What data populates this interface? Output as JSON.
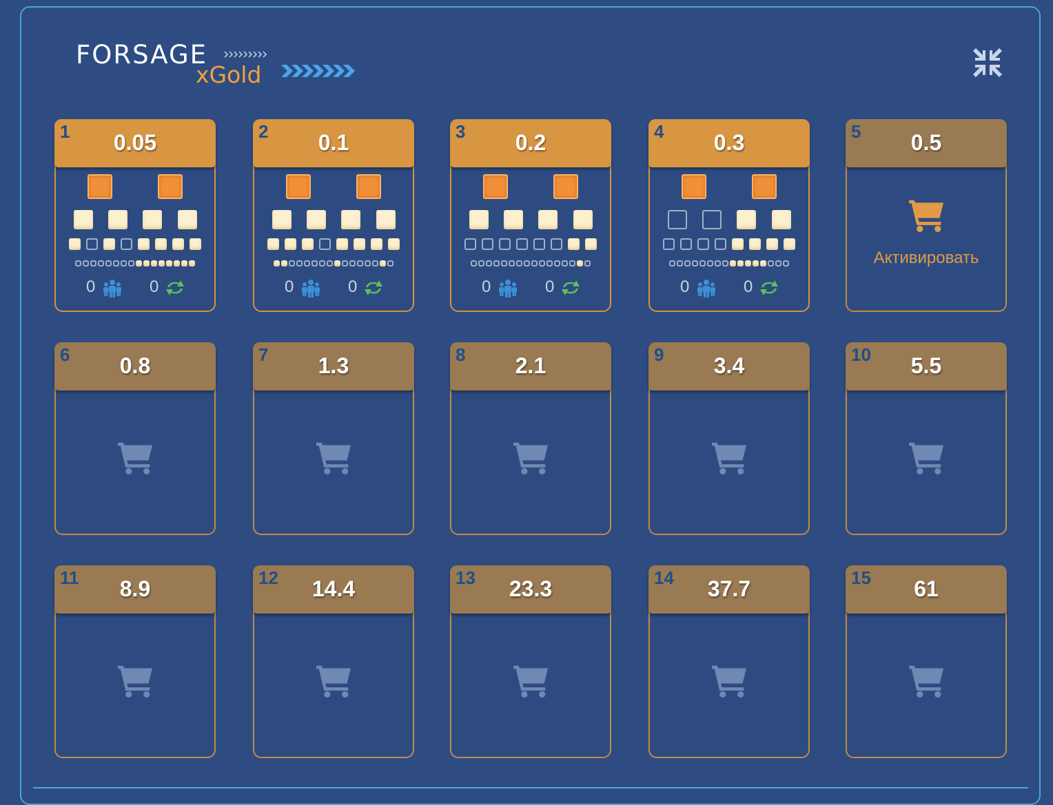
{
  "logo": {
    "brand": "FORSAGE",
    "product": "xGold"
  },
  "icons": {
    "collapse": "collapse-arrows-icon",
    "partners": "partners-icon",
    "reinvest": "reinvest-icon",
    "cart": "cart-icon"
  },
  "colors": {
    "background": "#2d4c80",
    "accent": "#d89542",
    "locked": "#9a7a52",
    "border": "#4aa6d8",
    "cart_faded": "#6f88b4"
  },
  "activate_label": "Активировать",
  "levels": [
    {
      "num": "1",
      "price": "0.05",
      "state": "active",
      "partners": "0",
      "reinvests": "0",
      "row1": [
        "orange",
        "orange"
      ],
      "row2": [
        "full",
        "full",
        "full",
        "full"
      ],
      "row3": [
        "full",
        "empty",
        "full",
        "empty",
        "full",
        "full",
        "full",
        "full"
      ],
      "row4": [
        "e",
        "e",
        "e",
        "e",
        "e",
        "e",
        "e",
        "e",
        "f",
        "f",
        "f",
        "f",
        "f",
        "f",
        "f",
        "f"
      ]
    },
    {
      "num": "2",
      "price": "0.1",
      "state": "active",
      "partners": "0",
      "reinvests": "0",
      "row1": [
        "orange",
        "orange"
      ],
      "row2": [
        "full",
        "full",
        "full",
        "full"
      ],
      "row3": [
        "full",
        "full",
        "full",
        "empty",
        "full",
        "full",
        "full",
        "full"
      ],
      "row4": [
        "f",
        "f",
        "e",
        "e",
        "e",
        "e",
        "e",
        "e",
        "f",
        "e",
        "e",
        "e",
        "e",
        "e",
        "f",
        "e"
      ]
    },
    {
      "num": "3",
      "price": "0.2",
      "state": "active",
      "partners": "0",
      "reinvests": "0",
      "row1": [
        "orange",
        "orange"
      ],
      "row2": [
        "full",
        "full",
        "full",
        "full"
      ],
      "row3": [
        "empty",
        "empty",
        "empty",
        "empty",
        "empty",
        "empty",
        "full",
        "full"
      ],
      "row4": [
        "e",
        "e",
        "e",
        "e",
        "e",
        "e",
        "e",
        "e",
        "e",
        "e",
        "e",
        "e",
        "e",
        "e",
        "f",
        "e"
      ]
    },
    {
      "num": "4",
      "price": "0.3",
      "state": "active",
      "partners": "0",
      "reinvests": "0",
      "row1": [
        "orange",
        "orange"
      ],
      "row2": [
        "empty",
        "empty",
        "full",
        "full"
      ],
      "row3": [
        "empty",
        "empty",
        "empty",
        "empty",
        "full",
        "full",
        "full",
        "full"
      ],
      "row4": [
        "e",
        "e",
        "e",
        "e",
        "e",
        "e",
        "e",
        "e",
        "f",
        "f",
        "f",
        "f",
        "f",
        "e",
        "e",
        "e"
      ]
    },
    {
      "num": "5",
      "price": "0.5",
      "state": "activate"
    },
    {
      "num": "6",
      "price": "0.8",
      "state": "locked"
    },
    {
      "num": "7",
      "price": "1.3",
      "state": "locked"
    },
    {
      "num": "8",
      "price": "2.1",
      "state": "locked"
    },
    {
      "num": "9",
      "price": "3.4",
      "state": "locked"
    },
    {
      "num": "10",
      "price": "5.5",
      "state": "locked"
    },
    {
      "num": "11",
      "price": "8.9",
      "state": "locked"
    },
    {
      "num": "12",
      "price": "14.4",
      "state": "locked"
    },
    {
      "num": "13",
      "price": "23.3",
      "state": "locked"
    },
    {
      "num": "14",
      "price": "37.7",
      "state": "locked"
    },
    {
      "num": "15",
      "price": "61",
      "state": "locked"
    }
  ]
}
